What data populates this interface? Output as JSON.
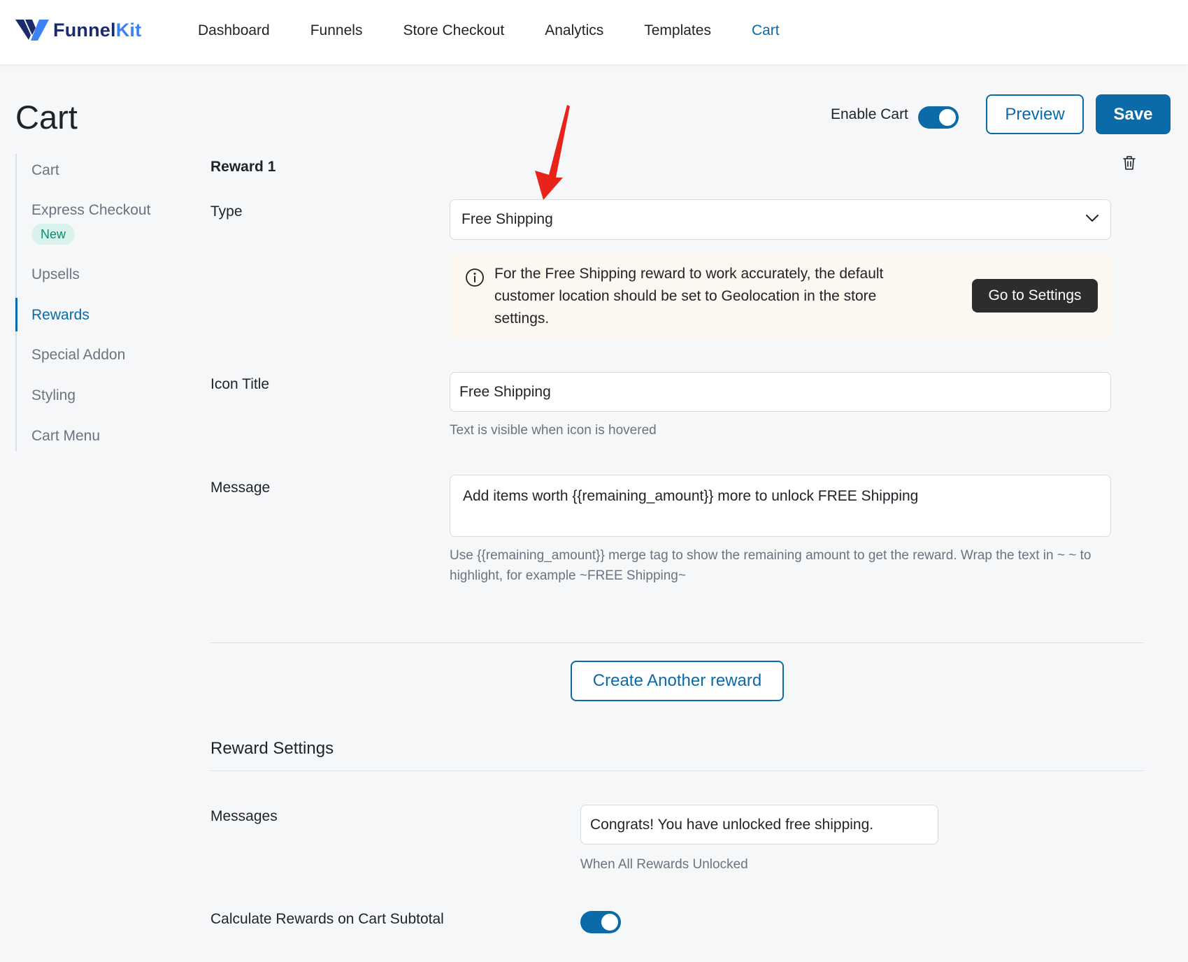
{
  "brand": {
    "logo_name": "Funnel",
    "logo_kit": "Kit"
  },
  "nav": {
    "items": [
      {
        "label": "Dashboard",
        "active": false
      },
      {
        "label": "Funnels",
        "active": false
      },
      {
        "label": "Store Checkout",
        "active": false
      },
      {
        "label": "Analytics",
        "active": false
      },
      {
        "label": "Templates",
        "active": false
      },
      {
        "label": "Cart",
        "active": true
      }
    ]
  },
  "header": {
    "title": "Cart",
    "enable_cart_label": "Enable Cart",
    "enable_cart_on": true,
    "preview_label": "Preview",
    "save_label": "Save"
  },
  "sidebar": {
    "items": [
      {
        "label": "Cart"
      },
      {
        "label": "Express Checkout",
        "badge": "New"
      },
      {
        "label": "Upsells"
      },
      {
        "label": "Rewards",
        "active": true
      },
      {
        "label": "Special Addon"
      },
      {
        "label": "Styling"
      },
      {
        "label": "Cart Menu"
      }
    ]
  },
  "reward": {
    "heading": "Reward 1",
    "type_label": "Type",
    "type_value": "Free Shipping",
    "notice_text": "For the Free Shipping reward to work accurately, the default customer location should be set to Geolocation in the store settings.",
    "notice_button": "Go to Settings",
    "icon_title_label": "Icon Title",
    "icon_title_value": "Free Shipping",
    "icon_title_help": "Text is visible when icon is hovered",
    "message_label": "Message",
    "message_value": "Add items worth {{remaining_amount}} more to unlock FREE Shipping",
    "message_help": "Use {{remaining_amount}} merge tag to show the remaining amount to get the reward. Wrap the text in ~ ~ to highlight, for example ~FREE Shipping~"
  },
  "create_button": "Create Another reward",
  "reward_settings": {
    "title": "Reward Settings",
    "messages_label": "Messages",
    "messages_value": "Congrats! You have unlocked free shipping.",
    "messages_help": "When All Rewards Unlocked",
    "subtotal_label": "Calculate Rewards on Cart Subtotal",
    "subtotal_on": true
  },
  "colors": {
    "accent": "#0b6aa8",
    "annotation_arrow": "#e8231a",
    "badge_bg": "#d9f3ec",
    "notice_bg": "#fcf8ef"
  },
  "icons": {
    "trash": "trash-icon",
    "chevron": "chevron-down-icon",
    "info": "info-icon",
    "arrow": "annotation-arrow"
  }
}
